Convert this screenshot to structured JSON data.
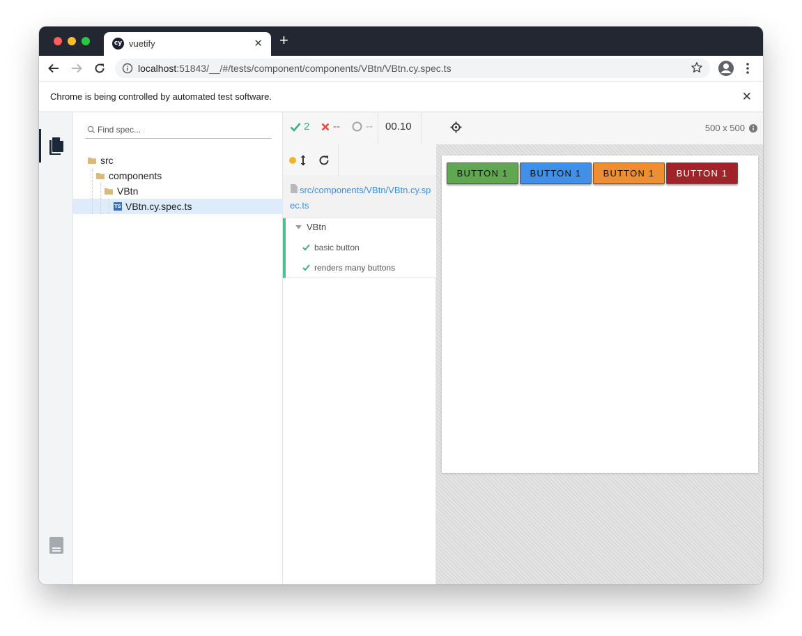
{
  "browser": {
    "tab_title": "vuetify",
    "tab_favicon": "cy",
    "new_tab": "+",
    "close_tab": "✕",
    "url_host": "localhost",
    "url_rest": ":51843/__/#/tests/component/components/VBtn/VBtn.cy.spec.ts"
  },
  "infobar": {
    "message": "Chrome is being controlled by automated test software.",
    "close": "✕"
  },
  "leftnav": {
    "items": [
      {
        "icon": "files-icon",
        "active": true
      },
      {
        "icon": "docs-icon",
        "active": false
      }
    ]
  },
  "specs": {
    "search_placeholder": "Find spec...",
    "tree": {
      "src": "src",
      "components": "components",
      "vbtn_folder": "VBtn",
      "file": "VBtn.cy.spec.ts",
      "file_badge": "TS"
    }
  },
  "reporter": {
    "passed": "2",
    "failed": "--",
    "pending": "--",
    "duration": "00.10",
    "spec_path": "src/components/VBtn/VBtn.cy.spec.ts",
    "suite": "VBtn",
    "tests": [
      "basic button",
      "renders many buttons"
    ]
  },
  "aut": {
    "viewport": "500 x 500",
    "buttons": [
      {
        "label": "BUTTON 1",
        "color": "#5fa84f",
        "text_color": "#111111"
      },
      {
        "label": "BUTTON 1",
        "color": "#3f90e6",
        "text_color": "#111111"
      },
      {
        "label": "BUTTON 1",
        "color": "#ee8e33",
        "text_color": "#111111"
      },
      {
        "label": "BUTTON 1",
        "color": "#a2222a",
        "text_color": "#ffffff"
      }
    ]
  },
  "colors": {
    "pass": "#3fae7e",
    "fail": "#e2483d",
    "accent": "#3c8de0"
  }
}
